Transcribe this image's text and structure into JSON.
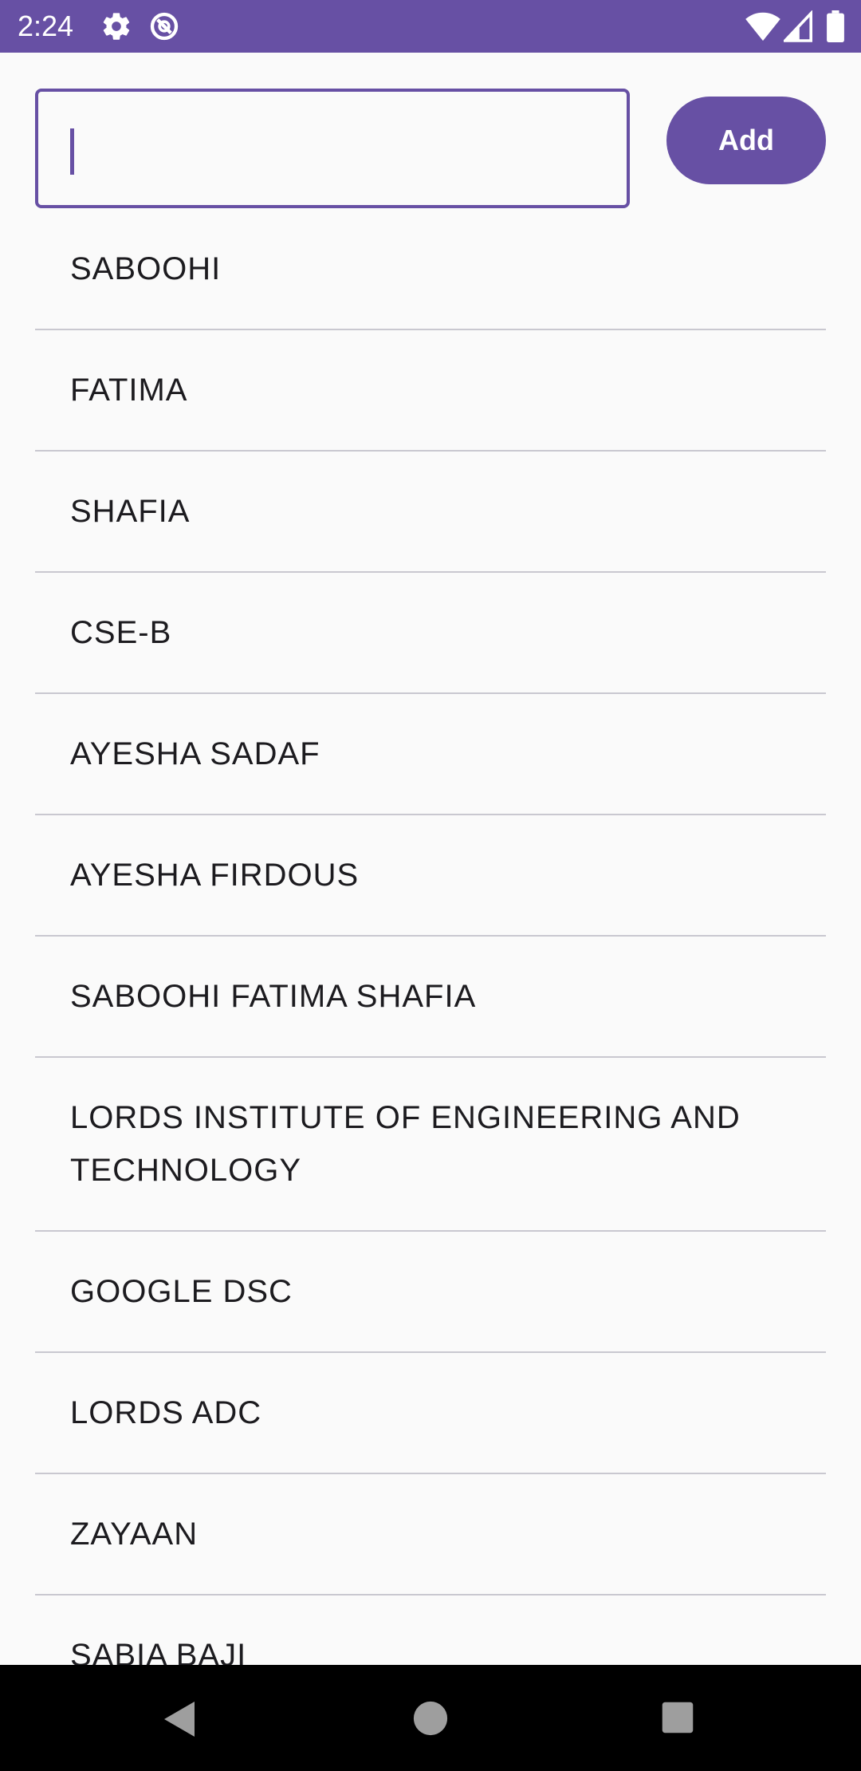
{
  "status_bar": {
    "time": "2:24",
    "icons": [
      "settings-icon",
      "data-saver-icon",
      "wifi-icon",
      "signal-icon",
      "battery-icon"
    ],
    "color": "#6750a4"
  },
  "input": {
    "value": "",
    "placeholder": ""
  },
  "add_button": {
    "label": "Add"
  },
  "list": {
    "items": [
      "SABOOHI",
      "FATIMA",
      "SHAFIA",
      "CSE-B",
      "AYESHA SADAF",
      "AYESHA FIRDOUS",
      "SABOOHI FATIMA SHAFIA",
      "LORDS INSTITUTE OF ENGINEERING AND TECHNOLOGY",
      "GOOGLE DSC",
      "LORDS ADC",
      "ZAYAAN",
      "SABIA BAJI"
    ]
  },
  "nav_bar": {
    "icons": [
      "back-icon",
      "home-icon",
      "recents-icon"
    ]
  },
  "colors": {
    "accent": "#6750a4",
    "divider": "#c9c8d0",
    "background": "#fafafa"
  }
}
